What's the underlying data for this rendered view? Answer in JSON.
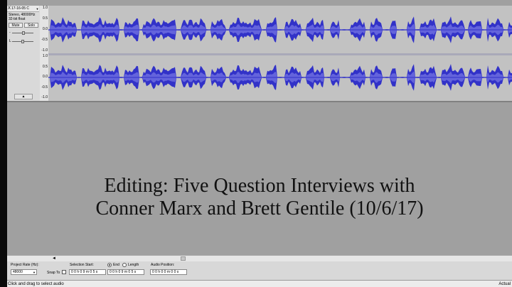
{
  "track": {
    "name": "17-16-05 C",
    "info_line1": "Stereo, 48000Hz",
    "info_line2": "32-bit float",
    "mute_label": "Mute",
    "solo_label": "Solo",
    "pan_left": "L",
    "pan_right": "R",
    "close_glyph": "X",
    "menu_glyph": "▼",
    "collapse_glyph": "▲"
  },
  "ruler": {
    "ch1": [
      "1.0",
      "0.5",
      "0.0",
      "-0.5",
      "-1.0"
    ],
    "ch2": [
      "1.0",
      "0.5",
      "0.0",
      "-0.5",
      "-1.0"
    ]
  },
  "title": {
    "line1": "Editing: Five Question Interviews with",
    "line2": "Conner Marx and Brett Gentile (10/6/17)"
  },
  "selection_toolbar": {
    "project_rate_label": "Project Rate (Hz):",
    "project_rate_value": "48000",
    "snap_to_label": "Snap To",
    "selection_start_label": "Selection Start:",
    "selection_start_value": "0 0 h 0 9 m 0 5 s",
    "end_label": "End",
    "length_label": "Length",
    "end_value": "0 0 h 0 9 m 0 5 s",
    "audio_position_label": "Audio Position:",
    "audio_position_value": "0 0 h 0 0 m 0 0 s"
  },
  "status": {
    "left": "Click and drag to select audio",
    "right": "Actual"
  },
  "scroll_arrow": "◄",
  "colors": {
    "waveform": "#3232c8",
    "waveform_rms": "#6464dc",
    "track_background": "#c2c2c2",
    "canvas": "#a0a0a0"
  }
}
